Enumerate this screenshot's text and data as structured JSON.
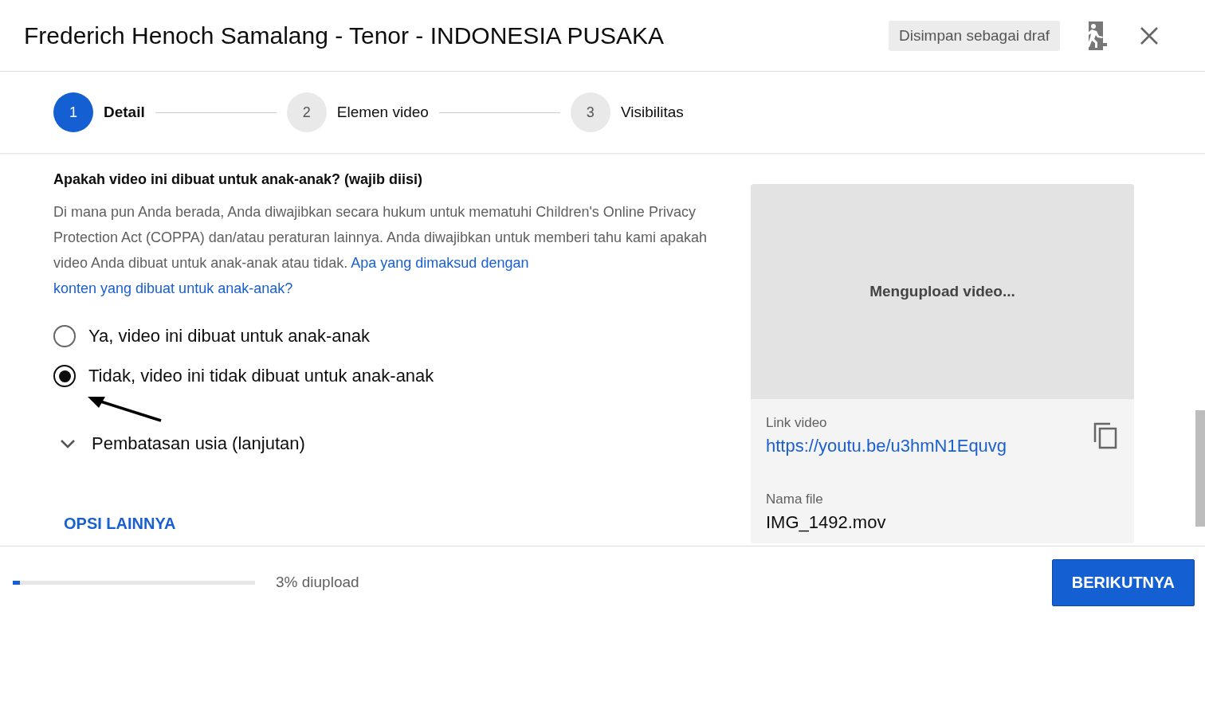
{
  "header": {
    "title": "Frederich Henoch Samalang - Tenor - INDONESIA PUSAKA",
    "draft_badge": "Disimpan sebagai draf"
  },
  "steps": [
    {
      "number": "1",
      "label": "Detail",
      "selected": true
    },
    {
      "number": "2",
      "label": "Elemen video",
      "selected": false
    },
    {
      "number": "3",
      "label": "Visibilitas",
      "selected": false
    }
  ],
  "audience": {
    "heading": "Apakah video ini dibuat untuk anak-anak? (wajib diisi)",
    "description": "Di mana pun Anda berada, Anda diwajibkan secara hukum untuk mematuhi Children's Online Privacy Protection Act (COPPA) dan/atau peraturan lainnya. Anda diwajibkan untuk memberi tahu kami apakah video Anda dibuat untuk anak-anak atau tidak.",
    "link": [
      "Apa yang dimaksud dengan",
      "konten yang dibuat untuk anak-anak?"
    ],
    "options": [
      {
        "label": "Ya, video ini dibuat untuk anak-anak",
        "selected": false
      },
      {
        "label": "Tidak, video ini tidak dibuat untuk anak-anak",
        "selected": true
      }
    ]
  },
  "age_restriction": {
    "label": "Pembatasan usia (lanjutan)",
    "expanded": false
  },
  "more_options": "OPSI LAINNYA",
  "preview": {
    "status": "Mengupload video...",
    "link_label": "Link video",
    "link": "https://youtu.be/u3hmN1Equvg",
    "file_label": "Nama file",
    "file_name": "IMG_1492.mov"
  },
  "footer": {
    "upload": {
      "level": 0.03
    },
    "upload_text": "3% diupload",
    "next_button": "BERIKUTNYA"
  }
}
